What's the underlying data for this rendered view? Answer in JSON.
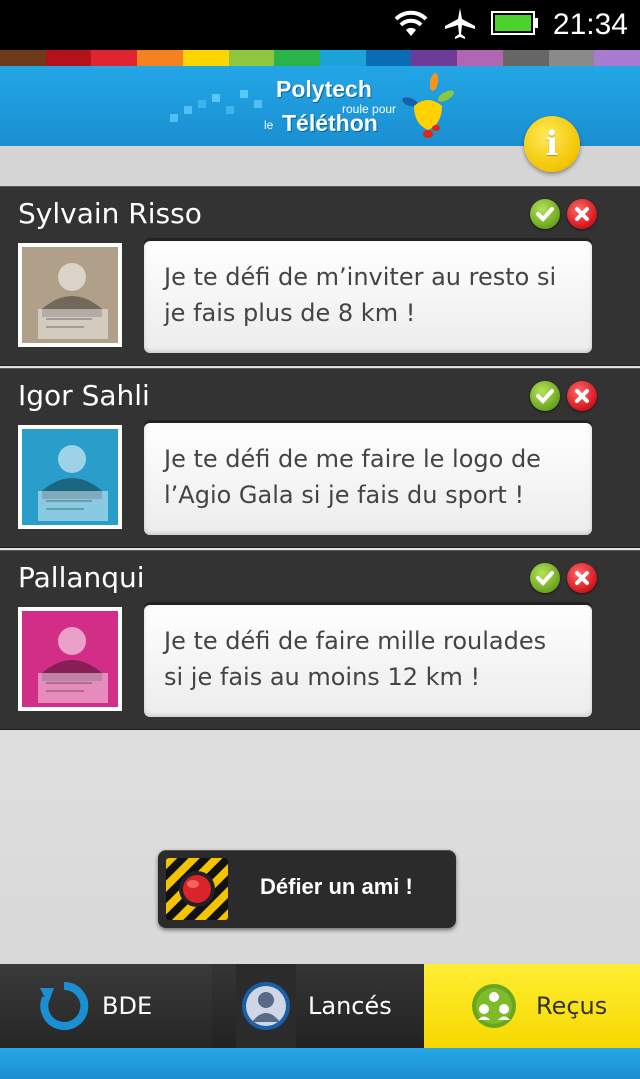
{
  "status_bar": {
    "time": "21:34",
    "icons": [
      "wifi-icon",
      "airplane-icon",
      "battery-icon"
    ]
  },
  "color_stripe": [
    "#6e3a1b",
    "#b3121b",
    "#e02431",
    "#f58220",
    "#fdd500",
    "#8ec63f",
    "#2ab34a",
    "#1ba2d9",
    "#0a6bb6",
    "#6e3b96",
    "#b066b0",
    "#666666",
    "#8a8a8a",
    "#a87bd1"
  ],
  "header": {
    "logo_line1": "Polytech",
    "logo_line2": "roule pour",
    "logo_line3": "le",
    "logo_line4": "Téléthon",
    "info_label": "i"
  },
  "challenges": [
    {
      "name": "Sylvain Risso",
      "message": "Je te défi de m’inviter au resto si je fais plus de 8 km !",
      "avatar_tint": "#c9b79c"
    },
    {
      "name": "Igor Sahli",
      "message": "Je te défi de me faire le logo de l’Agio Gala si je fais du sport !",
      "avatar_tint": "#2fb4e8"
    },
    {
      "name": "Pallanqui",
      "message": "Je te défi de faire mille roulades si je fais au moins 12 km !",
      "avatar_tint": "#f0359a"
    }
  ],
  "cta": {
    "label": "Défier un ami !"
  },
  "tabs": [
    {
      "label": "BDE",
      "icon": "refresh-icon",
      "selected": false
    },
    {
      "label": "Lancés",
      "icon": "user-icon",
      "selected": false
    },
    {
      "label": "Reçus",
      "icon": "group-icon",
      "selected": true
    }
  ],
  "colors": {
    "accent_blue": "#1a8fd1",
    "card_bg": "#333333",
    "selected_tab": "#f6d800",
    "accept_green": "#6aa51e",
    "reject_red": "#d4141d"
  }
}
